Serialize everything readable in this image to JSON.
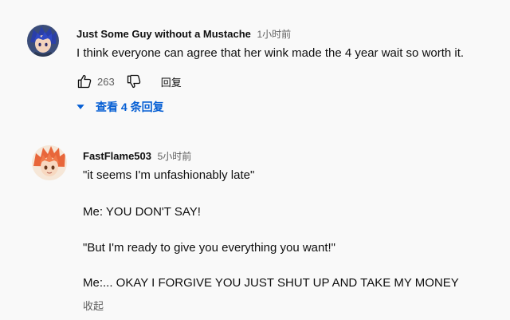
{
  "comments": [
    {
      "author": "Just Some Guy without a Mustache",
      "time": "1小时前",
      "text": "I think everyone can agree that her wink made the 4 year wait so worth it.",
      "likes": "263",
      "reply_label": "回复",
      "view_replies": "查看 4 条回复",
      "avatar_icon": "avatar-anime-blue-hair"
    },
    {
      "author": "FastFlame503",
      "time": "5小时前",
      "lines": [
        "\"it seems I'm unfashionably late\"",
        "Me: YOU DON'T SAY!",
        "\"But I'm ready to give you everything you want!\"",
        "Me:... OKAY I FORGIVE YOU JUST SHUT UP AND TAKE MY MONEY"
      ],
      "collapse_label": "收起",
      "avatar_icon": "avatar-anime-orange-hair"
    }
  ],
  "colors": {
    "background": "#f9f9f9",
    "text": "#0f0f0f",
    "secondary": "#606060",
    "link": "#065fd4"
  }
}
